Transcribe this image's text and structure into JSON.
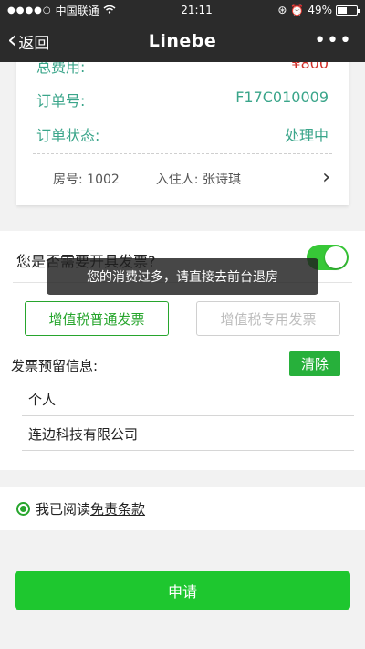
{
  "statusbar": {
    "carrier": "中国联通",
    "time": "21:11",
    "battery": "49%",
    "battery_level": 0.49
  },
  "nav": {
    "back_label": "返回",
    "title": "Linebe",
    "more": "•••"
  },
  "order": {
    "total_label": "总费用:",
    "total_value": "¥800",
    "order_no_label": "订单号:",
    "order_no_value": "F17C010009",
    "status_label": "订单状态:",
    "status_value": "处理中",
    "room_label": "房号: 1002",
    "guest_label": "入住人: 张诗琪"
  },
  "invoice": {
    "question": "您是否需要开具发票?",
    "toggle_on": true,
    "type_regular": "增值税普通发票",
    "type_special": "增值税专用发票",
    "reserved_label": "发票预留信息:",
    "clear_label": "清除",
    "fields": [
      "个人",
      "连边科技有限公司"
    ]
  },
  "agreement": {
    "prefix": "我已阅读",
    "link": "免责条款"
  },
  "submit_label": "申请",
  "toast": "您的消费过多，请直接去前台退房",
  "colors": {
    "accent_green": "#27a52d",
    "label_teal": "#3aa58a",
    "price_red": "#d0302a",
    "header_dark": "#2b2b2b"
  }
}
